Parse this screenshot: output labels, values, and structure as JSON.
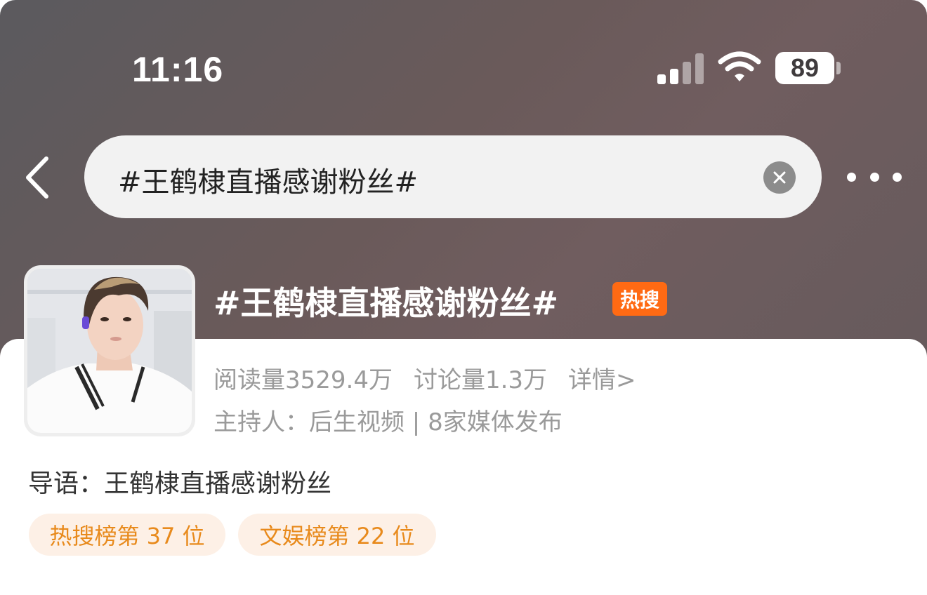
{
  "status_bar": {
    "time": "11:16",
    "battery": "89"
  },
  "search": {
    "query": "#王鹤棣直播感谢粉丝#"
  },
  "topic": {
    "title": "#王鹤棣直播感谢粉丝#",
    "badge": "热搜",
    "reads": "阅读量3529.4万",
    "discussions": "讨论量1.3万",
    "details_link": "详情>",
    "host_line": "主持人：后生视频 | 8家媒体发布",
    "intro": "导语：王鹤棣直播感谢粉丝"
  },
  "tags": [
    {
      "label": "热搜榜第 37 位"
    },
    {
      "label": "文娱榜第 22 位"
    }
  ],
  "colors": {
    "hero_bg": "#6a5b5c",
    "hot_badge": "#ff6a13",
    "tag_text": "#e88a1c",
    "tag_bg": "#fdf0e6",
    "meta_text": "#9a9a9a"
  }
}
